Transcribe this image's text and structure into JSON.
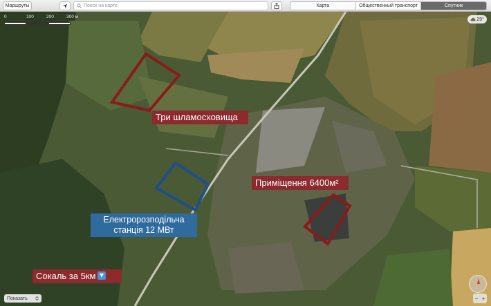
{
  "toolbar": {
    "routes_label": "Маршруты",
    "search_placeholder": "Поиск на карте",
    "map_types": [
      "Карта",
      "Общественный транспорт",
      "Спутник"
    ],
    "active_map_type": "Спутник"
  },
  "scale": {
    "labels": [
      "0",
      "100",
      "200",
      "300 м"
    ]
  },
  "weather": {
    "temperature": "29°",
    "icon": "cloud-icon"
  },
  "annotations": {
    "storage": "Три шламосховища",
    "premises": "Приміщення 6400м²",
    "station": "Електророзподільча станція 12 МВт",
    "sokal": "Сокаль за 5км"
  },
  "colors": {
    "annotation_red": "#8c2a2e",
    "annotation_blue": "#2f6b9e",
    "outline_red": "#8b1a1a",
    "outline_blue": "#1f4f8a"
  },
  "bottom": {
    "show_label": "Показать"
  }
}
